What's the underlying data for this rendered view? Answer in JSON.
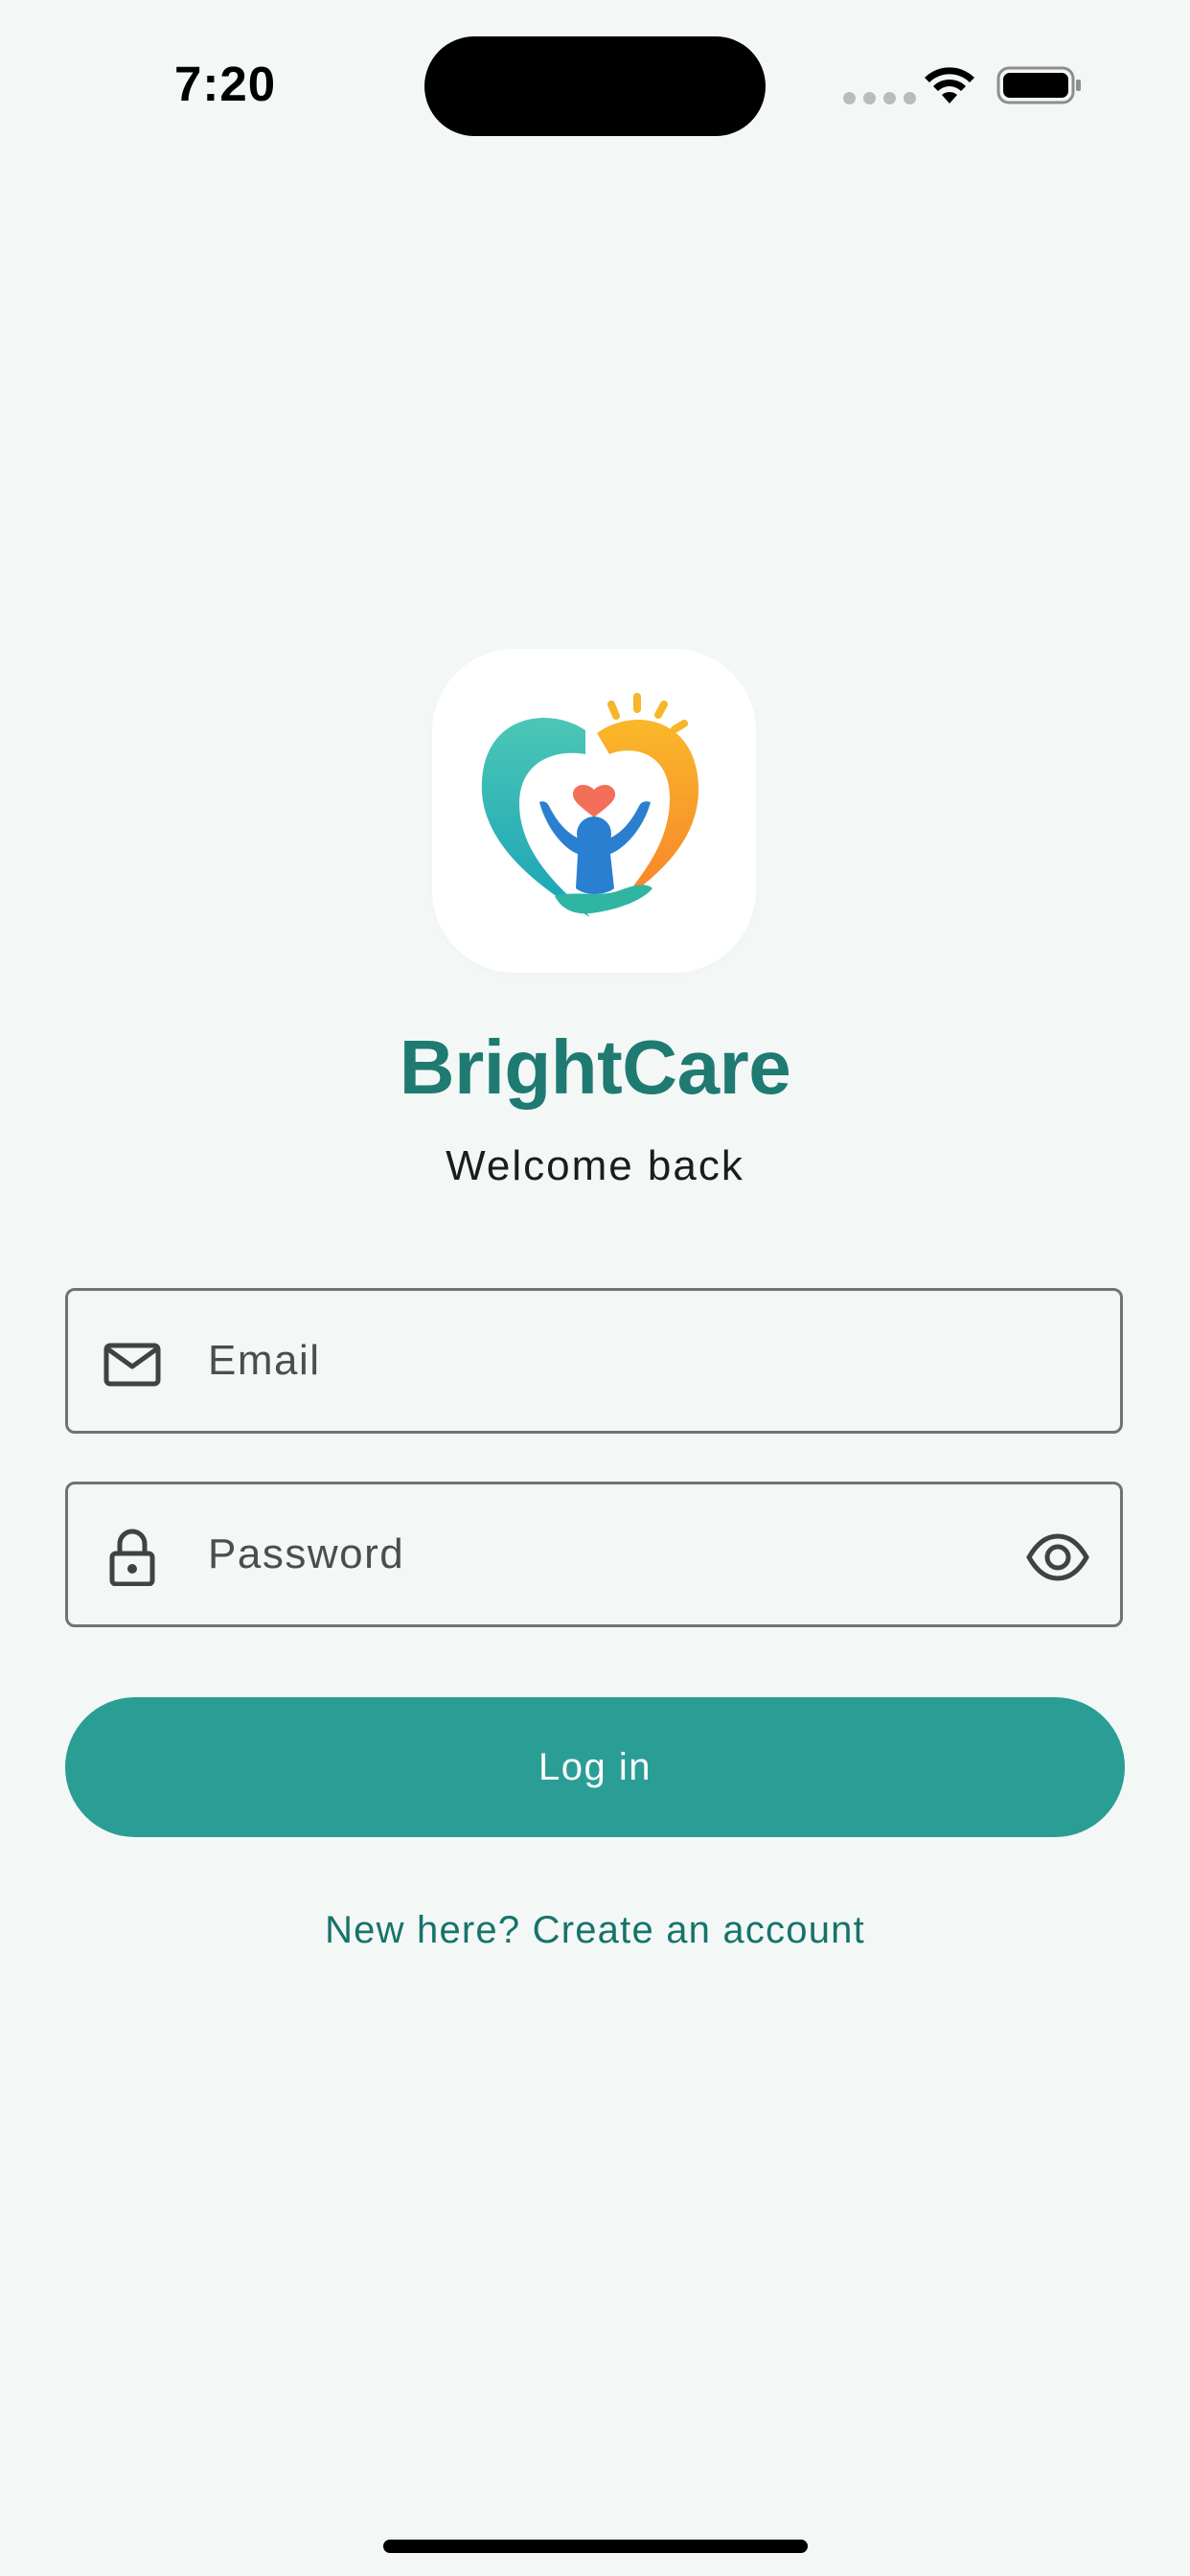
{
  "status_bar": {
    "time": "7:20",
    "icons": [
      "cellular-dots-icon",
      "wifi-icon",
      "battery-icon"
    ]
  },
  "app": {
    "name": "BrightCare",
    "subtitle": "Welcome back",
    "logo": "brightcare-heart-logo"
  },
  "form": {
    "email": {
      "placeholder": "Email",
      "value": "",
      "icon": "mail-icon"
    },
    "password": {
      "placeholder": "Password",
      "value": "",
      "icon": "lock-icon",
      "toggle_icon": "eye-icon"
    },
    "login_label": "Log in",
    "signup_label": "New here? Create an account"
  },
  "colors": {
    "background": "#f3f8f6",
    "brand_title": "#1f7a72",
    "button": "#2a9e95",
    "link": "#17736b"
  }
}
